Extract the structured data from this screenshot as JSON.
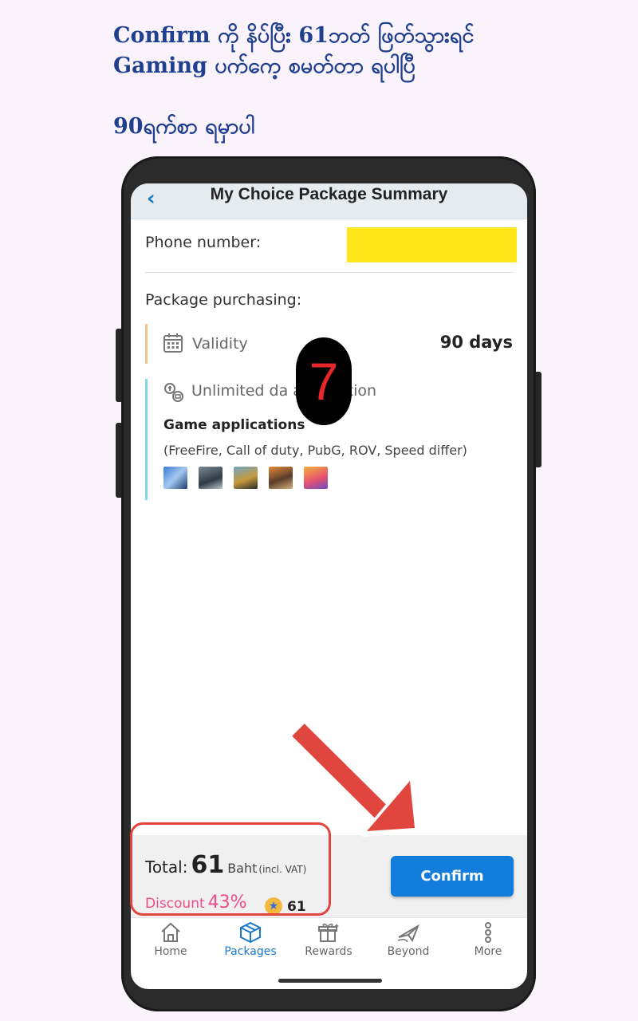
{
  "caption": {
    "line1": "Confirm ကို နိပ်ပြီး 61ဘတ် ဖြတ်သွားရင်",
    "line2": "Gaming ပက်ကေ့ စမတ်တာ ရပါပြီ",
    "line3": "90ရက်စာ ရမှာပါ"
  },
  "header": {
    "back": "‹",
    "title": "My Choice Package Summary"
  },
  "phone_number": {
    "label": "Phone number:"
  },
  "package": {
    "label": "Package purchasing:",
    "validity_label": "Validity",
    "validity_value": "90 days",
    "unlimited_label": "Unlimited da        application",
    "games_heading": "Game applications",
    "games_list": "(FreeFire, Call of duty, PubG, ROV, Speed differ)",
    "game_icons": [
      "freefire-icon",
      "call-of-duty-icon",
      "pubg-icon",
      "rov-icon",
      "speed-drifters-icon"
    ]
  },
  "step_badge": "7",
  "totals": {
    "total_label": "Total:",
    "total_amount": "61",
    "currency": "Baht",
    "vat_note": "(incl. VAT)",
    "discount_label": "Discount",
    "discount_value": "43%",
    "points": "61"
  },
  "confirm_label": "Confirm",
  "tabs": [
    {
      "label": "Home",
      "icon": "home-icon"
    },
    {
      "label": "Packages",
      "icon": "package-box-icon"
    },
    {
      "label": "Rewards",
      "icon": "gift-icon"
    },
    {
      "label": "Beyond",
      "icon": "plane-icon"
    },
    {
      "label": "More",
      "icon": "more-dots-icon"
    }
  ],
  "colors": {
    "accent": "#137ddc",
    "highlight": "#e0463e",
    "discount": "#ef4d8a",
    "mask": "#ffe619"
  }
}
